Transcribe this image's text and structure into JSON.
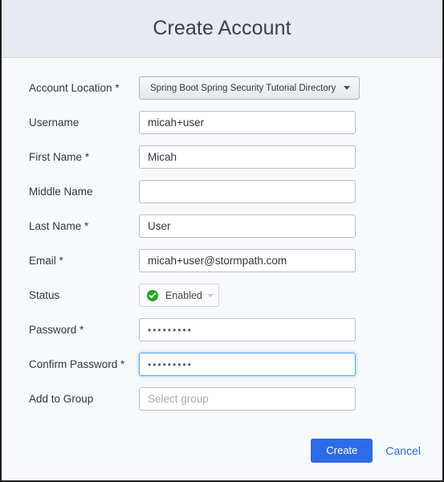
{
  "dialog": {
    "title": "Create Account"
  },
  "fields": {
    "account_location": {
      "label": "Account Location *",
      "value": "Spring Boot Spring Security Tutorial Directory"
    },
    "username": {
      "label": "Username",
      "value": "micah+user",
      "placeholder": ""
    },
    "first_name": {
      "label": "First Name *",
      "value": "Micah",
      "placeholder": ""
    },
    "middle_name": {
      "label": "Middle Name",
      "value": "",
      "placeholder": ""
    },
    "last_name": {
      "label": "Last Name *",
      "value": "User",
      "placeholder": ""
    },
    "email": {
      "label": "Email *",
      "value": "micah+user@stormpath.com",
      "placeholder": ""
    },
    "status": {
      "label": "Status",
      "value": "Enabled",
      "icon": "check-circle-icon",
      "icon_color": "#1aa81a"
    },
    "password": {
      "label": "Password *",
      "value": "•••••••••",
      "placeholder": ""
    },
    "confirm_password": {
      "label": "Confirm Password *",
      "value": "•••••••••",
      "placeholder": "",
      "focused": true
    },
    "add_to_group": {
      "label": "Add to Group",
      "value": "",
      "placeholder": "Select group"
    }
  },
  "footer": {
    "create_label": "Create",
    "cancel_label": "Cancel"
  },
  "colors": {
    "accent": "#2d6ce8",
    "header_bg": "#e8eaf2",
    "body_bg": "#f7f9fc",
    "status_green": "#1aa81a",
    "focus_border": "#5aa9f0"
  }
}
